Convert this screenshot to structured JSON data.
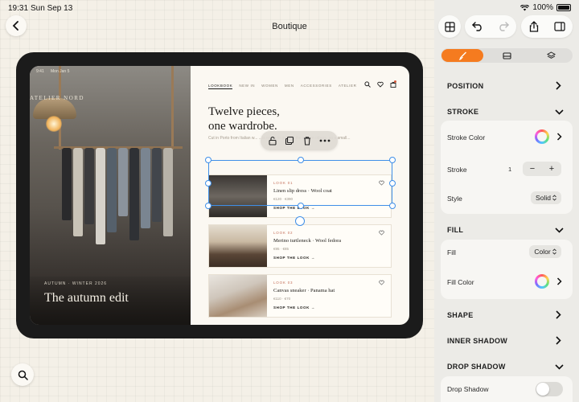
{
  "status": {
    "time": "19:31",
    "date": "Sun Sep 13",
    "battery": "100%"
  },
  "header": {
    "title": "Boutique"
  },
  "preview": {
    "status_time": "9:41",
    "status_date": "Mon Jan 5",
    "brand": "ATELIER NORD",
    "season": "AUTUMN · WINTER 2026",
    "hero_title": "The autumn edit",
    "nav": [
      "LOOKBOOK",
      "NEW IN",
      "WOMEN",
      "MEN",
      "ACCESSORIES",
      "ATELIER"
    ],
    "headline_line1": "Twelve pieces,",
    "headline_line2": "one wardrobe.",
    "intro": "Cut in Porto from Italian w... ...is made to go with the eleven others, so a small...",
    "cards": [
      {
        "kicker": "LOOK 01",
        "name": "Linen slip dress · Wool coat",
        "price": "€120 · €390",
        "shop": "SHOP THE LOOK →"
      },
      {
        "kicker": "LOOK 02",
        "name": "Merino turtleneck · Wool fedora",
        "price": "€95 · €85",
        "shop": "SHOP THE LOOK →"
      },
      {
        "kicker": "LOOK 03",
        "name": "Canvas sneaker · Panama hat",
        "price": "€110 · €70",
        "shop": "SHOP THE LOOK →"
      }
    ]
  },
  "inspector": {
    "position": "POSITION",
    "stroke": "STROKE",
    "stroke_color": "Stroke Color",
    "stroke_label": "Stroke",
    "stroke_value": "1",
    "style_label": "Style",
    "style_value": "Solid",
    "fill": "FILL",
    "fill_label": "Fill",
    "fill_value": "Color",
    "fill_color": "Fill Color",
    "shape": "SHAPE",
    "inner_shadow": "INNER SHADOW",
    "drop_shadow": "DROP SHADOW",
    "drop_shadow_label": "Drop Shadow",
    "drop_shadow_on": false
  },
  "colors": {
    "accent": "#f57b1f",
    "selection": "#3f8fe8"
  }
}
